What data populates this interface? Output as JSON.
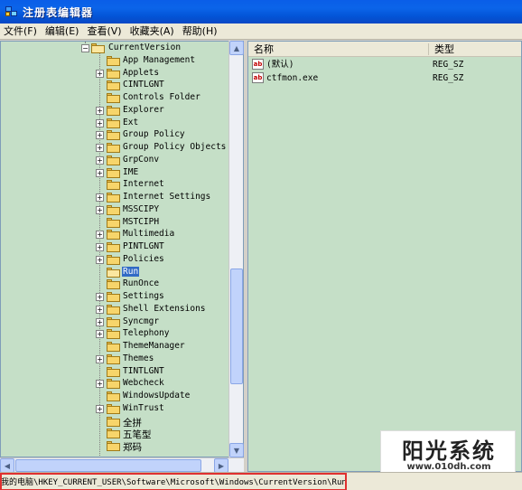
{
  "window": {
    "title": "注册表编辑器"
  },
  "menu": [
    {
      "label": "文件(F)"
    },
    {
      "label": "编辑(E)"
    },
    {
      "label": "查看(V)"
    },
    {
      "label": "收藏夹(A)"
    },
    {
      "label": "帮助(H)"
    }
  ],
  "tree": {
    "parent": {
      "label": "CurrentVersion",
      "expanded": true
    },
    "items": [
      {
        "label": "App Management",
        "expandable": false
      },
      {
        "label": "Applets",
        "expandable": true
      },
      {
        "label": "CINTLGNT",
        "expandable": false
      },
      {
        "label": "Controls Folder",
        "expandable": false
      },
      {
        "label": "Explorer",
        "expandable": true
      },
      {
        "label": "Ext",
        "expandable": true
      },
      {
        "label": "Group Policy",
        "expandable": true
      },
      {
        "label": "Group Policy Objects",
        "expandable": true
      },
      {
        "label": "GrpConv",
        "expandable": true
      },
      {
        "label": "IME",
        "expandable": true
      },
      {
        "label": "Internet",
        "expandable": false
      },
      {
        "label": "Internet Settings",
        "expandable": true
      },
      {
        "label": "MSSCIPY",
        "expandable": true
      },
      {
        "label": "MSTCIPH",
        "expandable": false
      },
      {
        "label": "Multimedia",
        "expandable": true
      },
      {
        "label": "PINTLGNT",
        "expandable": true
      },
      {
        "label": "Policies",
        "expandable": true
      },
      {
        "label": "Run",
        "expandable": false,
        "selected": true
      },
      {
        "label": "RunOnce",
        "expandable": false
      },
      {
        "label": "Settings",
        "expandable": true
      },
      {
        "label": "Shell Extensions",
        "expandable": true
      },
      {
        "label": "Syncmgr",
        "expandable": true
      },
      {
        "label": "Telephony",
        "expandable": true
      },
      {
        "label": "ThemeManager",
        "expandable": false
      },
      {
        "label": "Themes",
        "expandable": true
      },
      {
        "label": "TINTLGNT",
        "expandable": false
      },
      {
        "label": "Webcheck",
        "expandable": true
      },
      {
        "label": "WindowsUpdate",
        "expandable": false
      },
      {
        "label": "WinTrust",
        "expandable": true
      },
      {
        "label": "全拼",
        "expandable": false
      },
      {
        "label": "五笔型",
        "expandable": false
      },
      {
        "label": "郑码",
        "expandable": false
      }
    ]
  },
  "list": {
    "columns": {
      "name": "名称",
      "type": "类型"
    },
    "rows": [
      {
        "name": "(默认)",
        "type": "REG_SZ"
      },
      {
        "name": "ctfmon.exe",
        "type": "REG_SZ"
      }
    ]
  },
  "status": {
    "path": "我的电脑\\HKEY_CURRENT_USER\\Software\\Microsoft\\Windows\\CurrentVersion\\Run"
  },
  "watermark": {
    "title": "阳光系统",
    "url": "www.010dh.com"
  },
  "colors": {
    "pane_bg": "#c5dfc7",
    "selection": "#316ac5",
    "status_highlight": "#e03030"
  }
}
